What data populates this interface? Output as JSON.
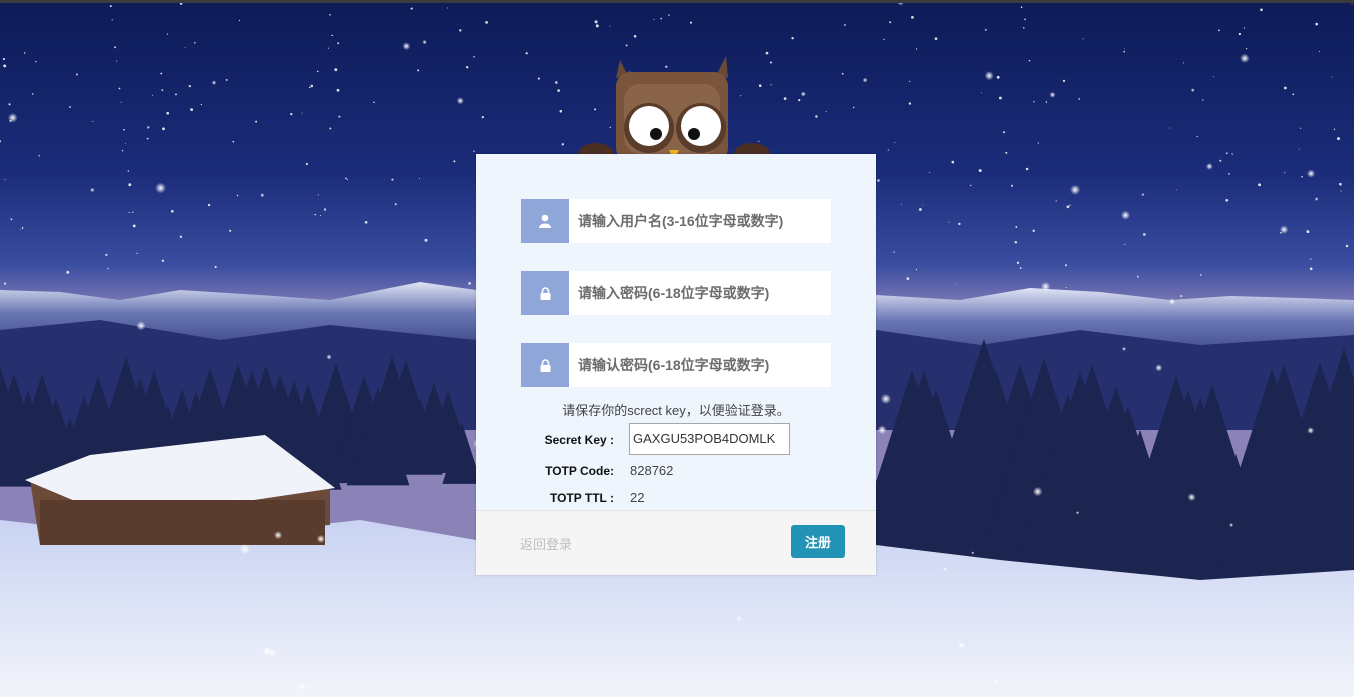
{
  "form": {
    "username_placeholder": "请输入用户名(3-16位字母或数字)",
    "password_placeholder": "请输入密码(6-18位字母或数字)",
    "confirm_placeholder": "请输认密码(6-18位字母或数字)",
    "notice": "请保存你的screct key，以便验证登录。",
    "secret_key_label": "Secret Key :",
    "secret_key_value": "GAXGU53POB4DOMLK",
    "totp_code_label": "TOTP Code:",
    "totp_code_value": "828762",
    "totp_ttl_label": "TOTP TTL :",
    "totp_ttl_value": "22"
  },
  "footer": {
    "back_label": "返回登录",
    "register_label": "注册"
  },
  "icons": {
    "username": "user-icon",
    "password": "lock-icon",
    "confirm": "lock-icon"
  },
  "colors": {
    "icon_bg": "#8fa6d8",
    "card_bg": "#eef5fc",
    "primary_button": "#2293b4"
  }
}
